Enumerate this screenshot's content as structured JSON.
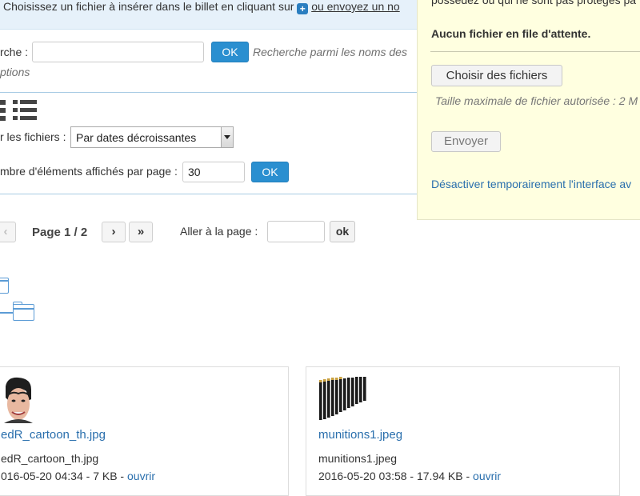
{
  "notice": {
    "text_before": "Choisissez un fichier à insérer dans le billet en cliquant sur",
    "text_after": "ou envoyez un no"
  },
  "search": {
    "label": "rche :",
    "value": "",
    "ok_label": "OK",
    "hint": "Recherche parmi les noms des",
    "options_link": "ptions"
  },
  "display": {
    "sort_label": "r les fichiers :",
    "sort_value": "Par dates décroissantes",
    "per_page_label": "mbre d'éléments affichés par page :",
    "per_page_value": "30",
    "ok_label": "OK"
  },
  "pagination": {
    "prev": "‹",
    "page_label": "Page 1 / 2",
    "next": "›",
    "last": "»",
    "goto_label": "Aller à la page :",
    "goto_value": "",
    "goto_ok": "ok"
  },
  "files": [
    {
      "title": "edR_cartoon_th.jpg",
      "filename": "edR_cartoon_th.jpg",
      "meta": "016-05-20 04:34 - 7 KB -",
      "open_link": "ouvrir"
    },
    {
      "title": "munitions1.jpeg",
      "filename": "munitions1.jpeg",
      "meta": "2016-05-20 03:58 - 17.94 KB -",
      "open_link": "ouvrir"
    }
  ],
  "upload": {
    "top_text": "possédez ou qui ne sont pas protégés pa",
    "queue_status": "Aucun fichier en file d'attente.",
    "choose_button": "Choisir des fichiers",
    "max_size": "Taille maximale de fichier autorisée : 2 M",
    "send_button": "Envoyer",
    "disable_link": "Désactiver temporairement l'interface av"
  },
  "colors": {
    "accent": "#2a8fd0",
    "link": "#2a6fad",
    "panel_bg": "#ffffe0",
    "notice_bg": "#e6f1fa"
  },
  "icons": [
    "plus-icon",
    "grid-view-icon",
    "list-view-icon",
    "folder-icon",
    "parent-folder-icon"
  ]
}
